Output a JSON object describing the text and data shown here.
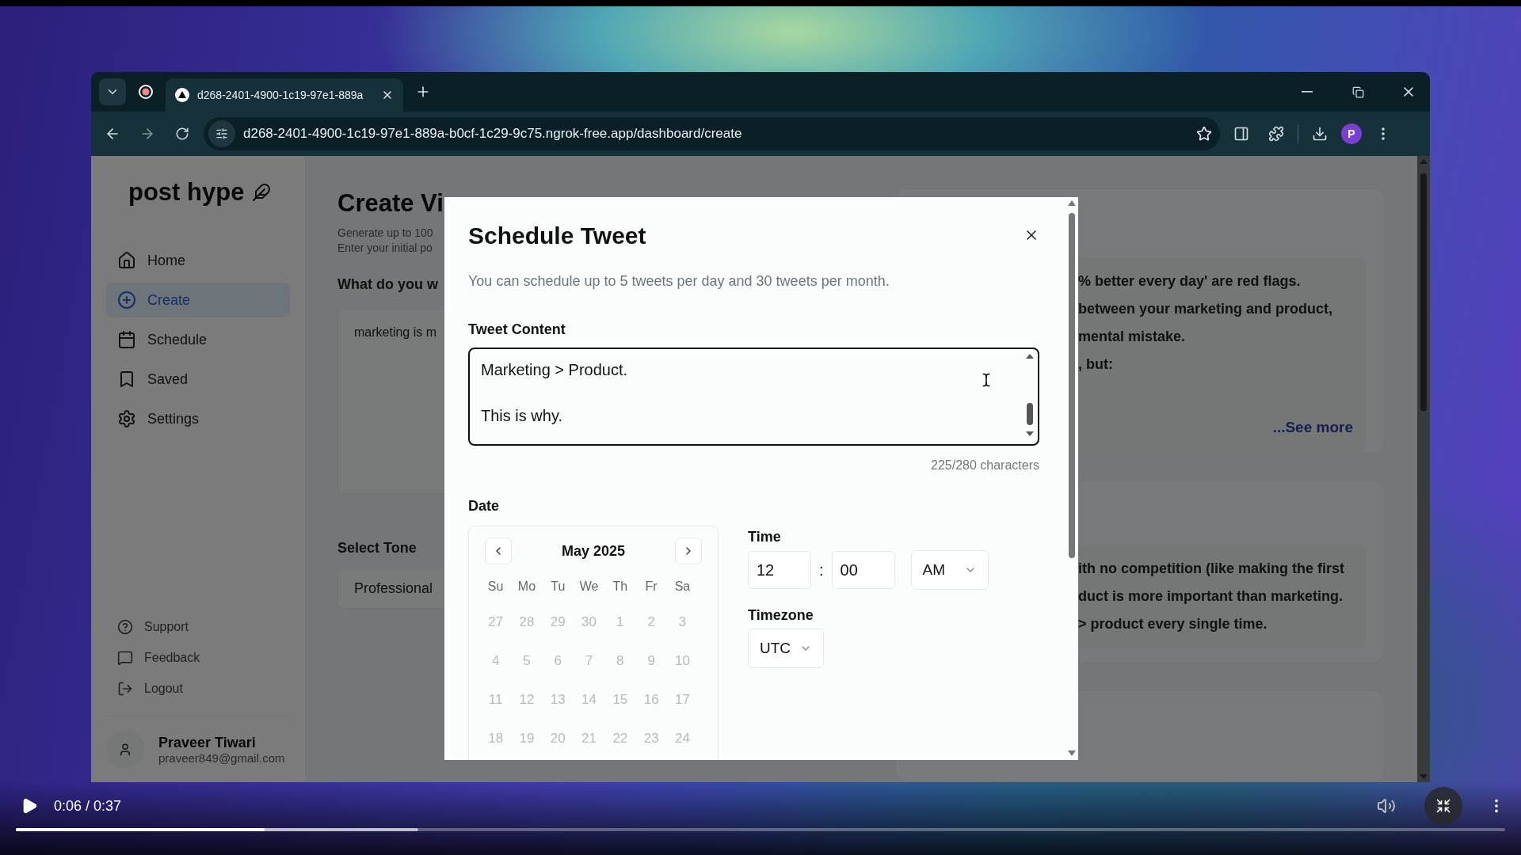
{
  "browser": {
    "tab": {
      "title": "d268-2401-4900-1c19-97e1-889a",
      "selected": true
    },
    "url": "d268-2401-4900-1c19-97e1-889a-b0cf-1c29-9c75.ngrok-free.app/dashboard/create",
    "profile": "P"
  },
  "sidebar": {
    "logo": "post hype",
    "items": [
      {
        "label": "Home",
        "selected": false
      },
      {
        "label": "Create",
        "selected": true
      },
      {
        "label": "Schedule",
        "selected": false
      },
      {
        "label": "Saved",
        "selected": false
      },
      {
        "label": "Settings",
        "selected": false
      }
    ],
    "footer_items": [
      "Support",
      "Feedback",
      "Logout"
    ],
    "user": {
      "name": "Praveer Tiwari",
      "email": "praveer849@gmail.com"
    }
  },
  "main": {
    "title": "Create Vi",
    "subtitle_lines": [
      "Generate up to 100",
      "Enter your initial po"
    ],
    "prompt_label": "What do you w",
    "prompt_value": "marketing is m",
    "tone_label": "Select Tone",
    "tone_value": "Professional"
  },
  "results": [
    {
      "lines": [
        "% better every day' are red flags.",
        "between your marketing and product,",
        "mental mistake.",
        ", but:"
      ],
      "link": "...See more"
    },
    {
      "lines": [
        "ith no competition (like making the first",
        "duct is more important than marketing.",
        "> product every single time."
      ]
    }
  ],
  "modal": {
    "title": "Schedule Tweet",
    "description": "You can schedule up to 5 tweets per day and 30 tweets per month.",
    "content_label": "Tweet Content",
    "content_value": "Marketing > Product.\n\nThis is why.",
    "counter": "225/280 characters",
    "date_label": "Date",
    "month": "May 2025",
    "weekdays": [
      "Su",
      "Mo",
      "Tu",
      "We",
      "Th",
      "Fr",
      "Sa"
    ],
    "weeks": [
      [
        {
          "label": "27",
          "disabled": true
        },
        {
          "label": "28",
          "disabled": true
        },
        {
          "label": "29",
          "disabled": true
        },
        {
          "label": "30",
          "disabled": true
        },
        {
          "label": "1",
          "disabled": true
        },
        {
          "label": "2",
          "disabled": true
        },
        {
          "label": "3",
          "disabled": true
        }
      ],
      [
        {
          "label": "4",
          "disabled": true
        },
        {
          "label": "5",
          "disabled": true
        },
        {
          "label": "6",
          "disabled": true
        },
        {
          "label": "7",
          "disabled": true
        },
        {
          "label": "8",
          "disabled": true
        },
        {
          "label": "9",
          "disabled": true
        },
        {
          "label": "10",
          "disabled": true
        }
      ],
      [
        {
          "label": "11",
          "disabled": true
        },
        {
          "label": "12",
          "disabled": true
        },
        {
          "label": "13",
          "disabled": true
        },
        {
          "label": "14",
          "disabled": true
        },
        {
          "label": "15",
          "disabled": true
        },
        {
          "label": "16",
          "disabled": true
        },
        {
          "label": "17",
          "disabled": true
        }
      ],
      [
        {
          "label": "18",
          "disabled": true
        },
        {
          "label": "19",
          "disabled": true
        },
        {
          "label": "20",
          "disabled": true
        },
        {
          "label": "21",
          "disabled": true
        },
        {
          "label": "22",
          "disabled": true
        },
        {
          "label": "23",
          "disabled": true
        },
        {
          "label": "24",
          "disabled": true
        }
      ]
    ],
    "time_label": "Time",
    "hour": "12",
    "separator": ":",
    "minute": "00",
    "period": "AM",
    "timezone_label": "Timezone",
    "timezone": "UTC"
  },
  "video": {
    "time": "0:06 / 0:37",
    "progress": {
      "level": 0.167
    },
    "buffer": {
      "level": 0.27
    }
  }
}
